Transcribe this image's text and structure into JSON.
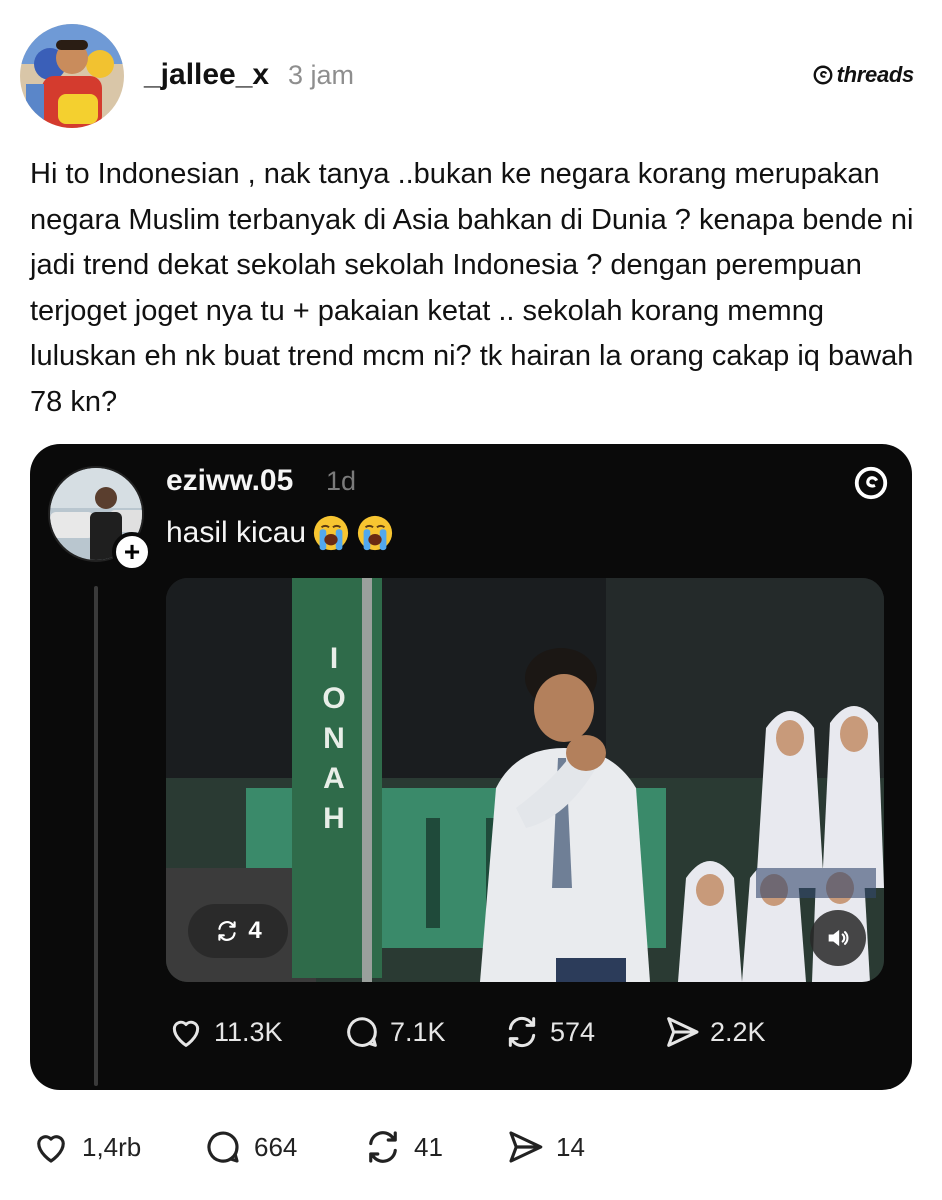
{
  "post": {
    "username": "_jallee_x",
    "timestamp": "3 jam",
    "brand": "threads",
    "text": "Hi to Indonesian , nak tanya ..bukan ke negara korang merupakan negara Muslim terbanyak di Asia bahkan di Dunia ? kenapa bende ni jadi trend dekat sekolah sekolah Indonesia ? dengan perempuan terjoget joget nya tu + pakaian ketat .. sekolah korang memng luluskan eh nk buat trend mcm ni? tk hairan la orang cakap iq bawah 78 kn?",
    "stats": {
      "likes": "1,4rb",
      "replies": "664",
      "reposts": "41",
      "shares": "14"
    }
  },
  "quoted": {
    "username": "eziww.05",
    "timestamp": "1d",
    "text": "hasil kicau",
    "emojis": [
      "loudly-crying-face-icon",
      "loudly-crying-face-icon"
    ],
    "media": {
      "repost_count": "4",
      "banner_text": "IONAH"
    },
    "stats": {
      "likes": "11.3K",
      "replies": "7.1K",
      "reposts": "574",
      "shares": "2.2K"
    }
  },
  "colors": {
    "card_bg": "#0a0a0a",
    "muted": "#8e8e8e",
    "text": "#111111"
  }
}
